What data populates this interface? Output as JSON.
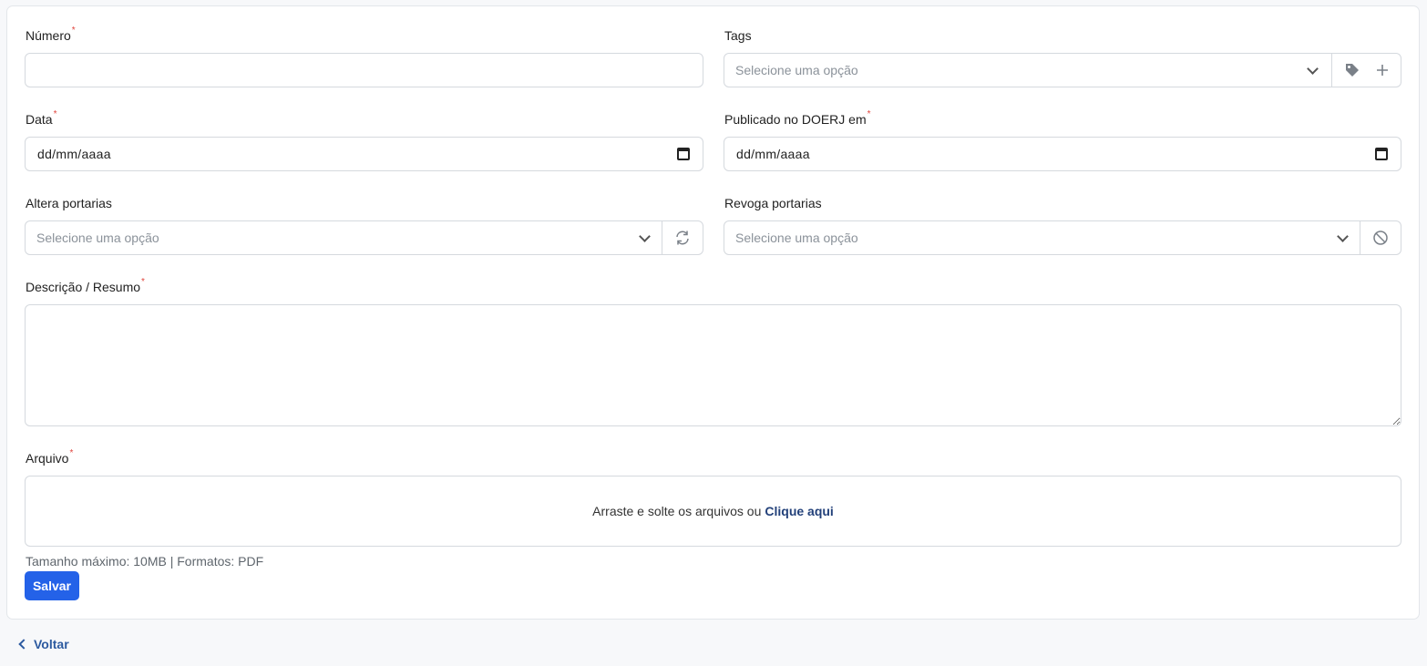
{
  "form": {
    "numero": {
      "label": "Número",
      "value": ""
    },
    "tags": {
      "label": "Tags",
      "placeholder": "Selecione uma opção"
    },
    "data": {
      "label": "Data",
      "value": "dd/mm/aaaa"
    },
    "publicado": {
      "label": "Publicado no DOERJ em",
      "value": "dd/mm/aaaa"
    },
    "altera": {
      "label": "Altera portarias",
      "placeholder": "Selecione uma opção"
    },
    "revoga": {
      "label": "Revoga portarias",
      "placeholder": "Selecione uma opção"
    },
    "descricao": {
      "label": "Descrição / Resumo",
      "value": ""
    },
    "arquivo": {
      "label": "Arquivo",
      "drop_text": "Arraste e solte os arquivos ou",
      "drop_link": "Clique aqui",
      "hint": "Tamanho máximo: 10MB | Formatos: PDF"
    },
    "required_mark": "*"
  },
  "actions": {
    "save_label": "Salvar",
    "back_label": "Voltar"
  },
  "icons": [
    "chevron-down-icon",
    "tag-icon",
    "plus-icon",
    "calendar-icon",
    "refresh-icon",
    "block-icon",
    "chevron-left-icon"
  ],
  "colors": {
    "primary": "#2462e8",
    "link": "#23417a",
    "required": "#e0443c"
  }
}
